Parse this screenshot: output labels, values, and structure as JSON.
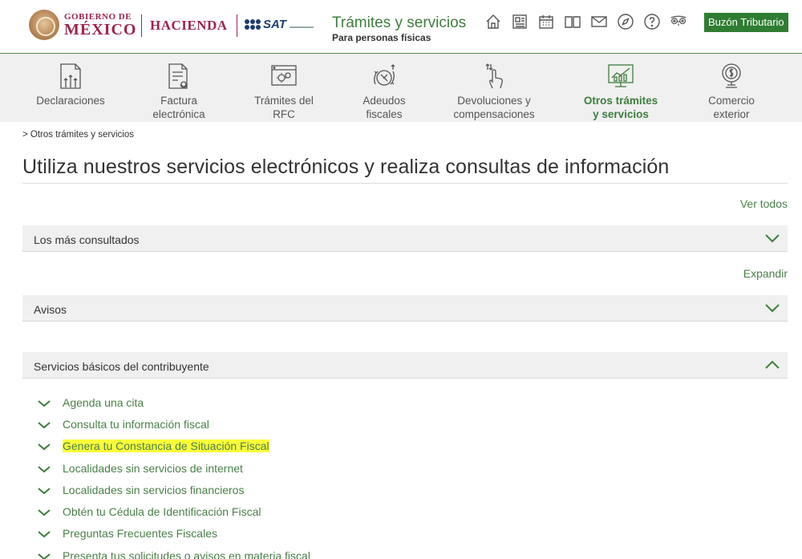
{
  "header": {
    "gob_line1": "GOBIERNO DE",
    "gob_line2": "MÉXICO",
    "hacienda": "HACIENDA",
    "sat": "SAT",
    "site_title": "Trámites y servicios",
    "site_subtitle": "Para personas físicas",
    "icons": [
      "home-icon",
      "newspaper-icon",
      "calendar-icon",
      "book-icon",
      "mail-icon",
      "compass-icon",
      "help-icon",
      "owl-icon"
    ],
    "buzon_label": "Buzón Tributario"
  },
  "nav": {
    "items": [
      {
        "label1": "Declaraciones",
        "label2": "",
        "icon": "declaraciones-icon"
      },
      {
        "label1": "Factura",
        "label2": "electrónica",
        "icon": "factura-icon"
      },
      {
        "label1": "Trámites del",
        "label2": "RFC",
        "icon": "rfc-icon"
      },
      {
        "label1": "Adeudos",
        "label2": "fiscales",
        "icon": "adeudos-icon"
      },
      {
        "label1": "Devoluciones y",
        "label2": "compensaciones",
        "icon": "devoluciones-icon"
      },
      {
        "label1": "Otros trámites",
        "label2": "y servicios",
        "icon": "otros-icon",
        "active": true
      },
      {
        "label1": "Comercio",
        "label2": "exterior",
        "icon": "comercio-icon"
      }
    ]
  },
  "breadcrumb": "> Otros trámites y servicios",
  "page_title": "Utiliza nuestros servicios electrónicos y realiza consultas de información",
  "ver_todos": "Ver todos",
  "expandir": "Expandir",
  "panels": {
    "mas_consultados": "Los más consultados",
    "avisos": "Avisos",
    "servicios_basicos": "Servicios básicos del contribuyente"
  },
  "services": [
    "Agenda una cita",
    "Consulta tu información fiscal",
    "Genera tu Constancia de Situación Fiscal",
    "Localidades sin servicios de internet",
    "Localidades sin servicios financieros",
    "Obtén tu Cédula de Identificación Fiscal",
    "Preguntas Frecuentes Fiscales",
    "Presenta tus solicitudes o avisos en materia fiscal"
  ],
  "highlighted_service": "Genera tu Constancia de Situación Fiscal",
  "colors": {
    "accent_green": "#3e7d3e",
    "brand_maroon": "#9d2449",
    "buzon_green": "#2e7d32",
    "highlight_yellow": "#fbff3a"
  }
}
